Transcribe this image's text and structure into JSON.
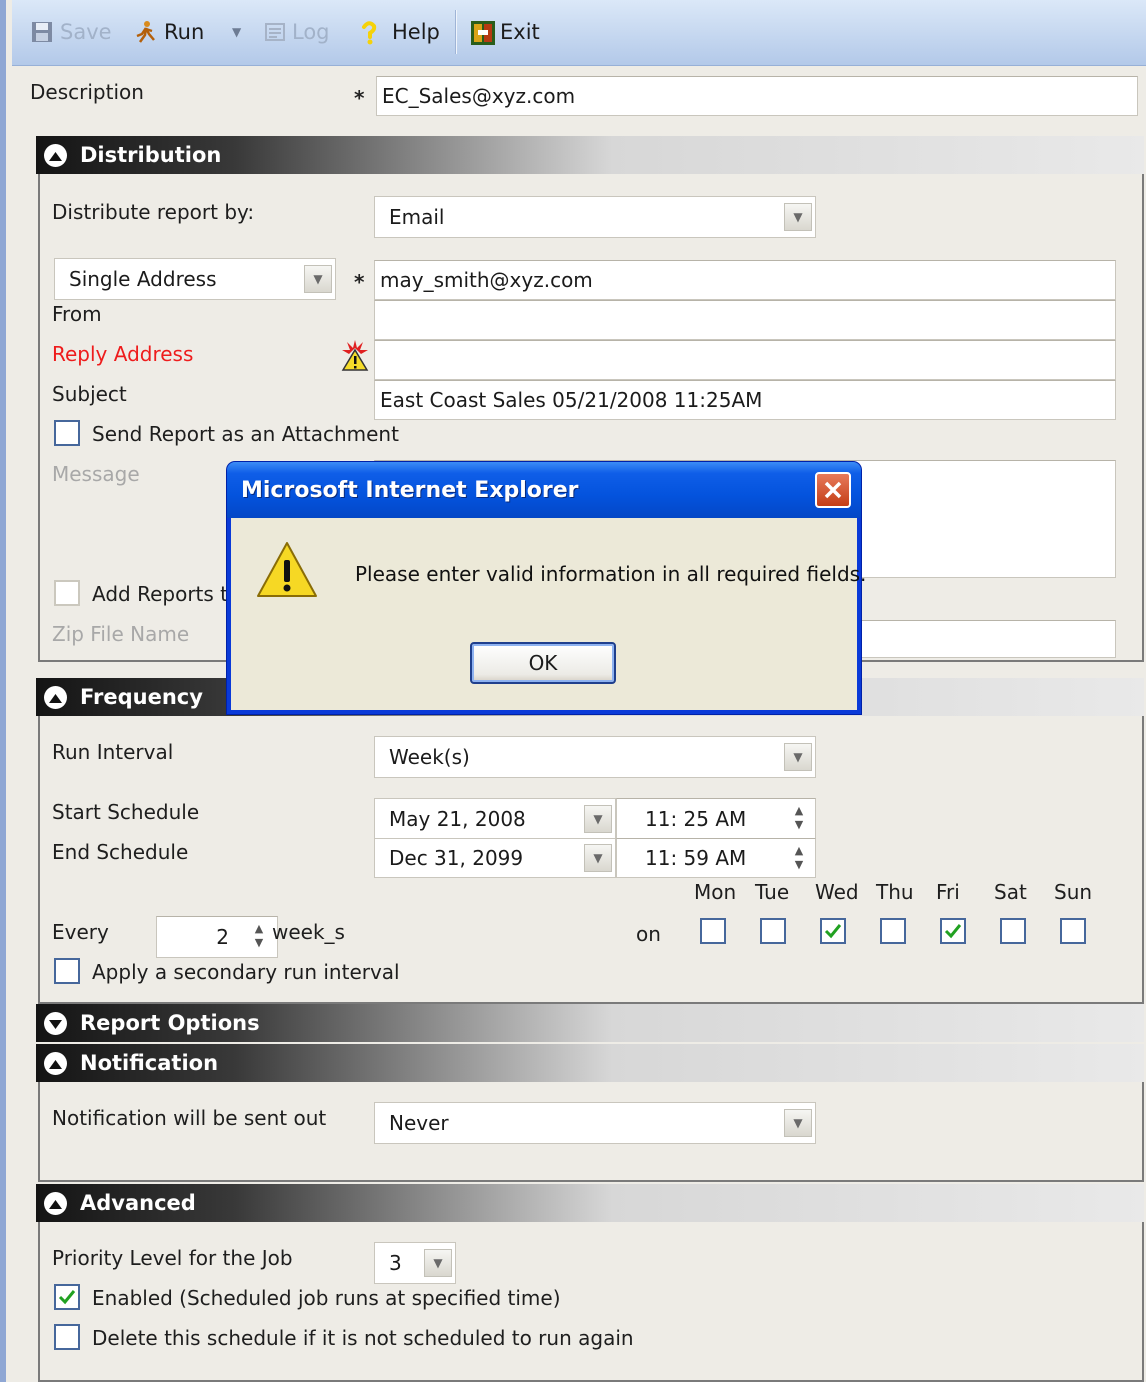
{
  "toolbar": {
    "save": "Save",
    "run": "Run",
    "log": "Log",
    "help": "Help",
    "exit": "Exit"
  },
  "description": {
    "label": "Description",
    "value": "EC_Sales@xyz.com"
  },
  "distribution": {
    "title": "Distribution",
    "distribute_by_label": "Distribute report by:",
    "distribute_by_value": "Email",
    "address_type": "Single Address",
    "to_value": "may_smith@xyz.com",
    "from_label": "From",
    "from_value": "",
    "reply_label": "Reply Address",
    "reply_value": "",
    "subject_label": "Subject",
    "subject_value": "East Coast Sales 05/21/2008 11:25AM",
    "attach_label": "Send Report as an Attachment",
    "attach_checked": false,
    "message_label": "Message",
    "add_reports_label": "Add Reports t",
    "zip_label": "Zip File Name"
  },
  "frequency": {
    "title": "Frequency",
    "run_interval_label": "Run Interval",
    "run_interval_value": "Week(s)",
    "start_label": "Start Schedule",
    "start_date": "May 21, 2008",
    "start_time": "11: 25 AM",
    "end_label": "End Schedule",
    "end_date": "Dec 31, 2099",
    "end_time": "11: 59 AM",
    "every_label": "Every",
    "every_value": "2",
    "every_unit": "week_s",
    "on_label": "on",
    "days": [
      {
        "name": "Mon",
        "checked": false
      },
      {
        "name": "Tue",
        "checked": false
      },
      {
        "name": "Wed",
        "checked": true
      },
      {
        "name": "Thu",
        "checked": false
      },
      {
        "name": "Fri",
        "checked": true
      },
      {
        "name": "Sat",
        "checked": false
      },
      {
        "name": "Sun",
        "checked": false
      }
    ],
    "secondary_label": "Apply a secondary run interval"
  },
  "report_options": {
    "title": "Report Options"
  },
  "notification": {
    "title": "Notification",
    "label": "Notification will be sent out",
    "value": "Never"
  },
  "advanced": {
    "title": "Advanced",
    "priority_label": "Priority Level for the Job",
    "priority_value": "3",
    "enabled_label": "Enabled (Scheduled job runs at specified time)",
    "enabled_checked": true,
    "delete_label": "Delete this schedule if it is not scheduled to run again",
    "delete_checked": false
  },
  "dialog": {
    "title": "Microsoft Internet Explorer",
    "message": "Please enter valid information in all required fields.",
    "ok": "OK"
  },
  "required_mark": "*",
  "colors": {
    "toolbar_bg": "#c9daf1",
    "section_header_dark": "#141414",
    "error_label": "#ee1c1c",
    "dialog_title": "#0453dd",
    "checkbox_border": "#46679b",
    "check_green": "#21a121"
  }
}
